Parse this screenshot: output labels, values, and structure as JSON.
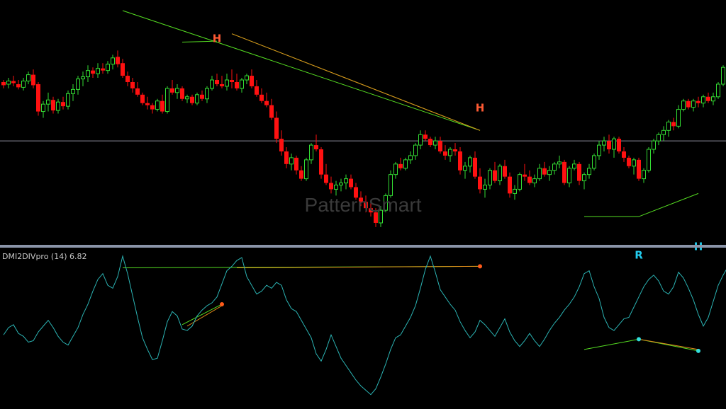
{
  "watermark": "PatternSmart",
  "indicator": {
    "title": "DMI2DIVpro (14) 6.82"
  },
  "colors": {
    "background": "#000000",
    "bull": "#33dd33",
    "bear": "#ff1111",
    "hline": "#8a8a9a",
    "separator": "#8a94a8",
    "line": "#2bb3b3",
    "green_trend": "#55dd22",
    "orange_trend": "#e08a1a",
    "label_orange": "#ff5a33",
    "label_cyan": "#22ccee",
    "dot_orange": "#ff5a1a",
    "dot_cyan": "#33dddd"
  },
  "chart_data": [
    {
      "type": "candlestick",
      "name": "price",
      "price_range": [
        0,
        100
      ],
      "horizontal_line": 38,
      "candles": [
        [
          66,
          67,
          63,
          64.5
        ],
        [
          65,
          68,
          63,
          66.5
        ],
        [
          66.5,
          69,
          64,
          65.5
        ],
        [
          65,
          67,
          62.5,
          63.5
        ],
        [
          63.5,
          68,
          62,
          66.5
        ],
        [
          66.5,
          71,
          65,
          69.5
        ],
        [
          69.5,
          72,
          63,
          64.5
        ],
        [
          65,
          66,
          50,
          52
        ],
        [
          52,
          57,
          49,
          55.5
        ],
        [
          55.5,
          61,
          52,
          57.5
        ],
        [
          57.5,
          59,
          51,
          52.5
        ],
        [
          52.5,
          58,
          51,
          56.5
        ],
        [
          56.5,
          59,
          53,
          54.5
        ],
        [
          54.5,
          62,
          53,
          60.5
        ],
        [
          60.5,
          65,
          57,
          62.5
        ],
        [
          62.5,
          69,
          60,
          67.5
        ],
        [
          67.5,
          71,
          64,
          68.5
        ],
        [
          68.5,
          74,
          66,
          71.5
        ],
        [
          71.5,
          73,
          68,
          70
        ],
        [
          70,
          75,
          68,
          72.5
        ],
        [
          72.5,
          75,
          70,
          71.5
        ],
        [
          71.5,
          76,
          70,
          74.5
        ],
        [
          74.5,
          79,
          72,
          77.5
        ],
        [
          78,
          81,
          73,
          74.5
        ],
        [
          75,
          77,
          68,
          69
        ],
        [
          69,
          71,
          64,
          66
        ],
        [
          66,
          68,
          61,
          63
        ],
        [
          63,
          66,
          59,
          60
        ],
        [
          60,
          61,
          55,
          56
        ],
        [
          56,
          59,
          53,
          55
        ],
        [
          55,
          56,
          51,
          53
        ],
        [
          53,
          58,
          52,
          57
        ],
        [
          57,
          60,
          51,
          52
        ],
        [
          52,
          64,
          51,
          63
        ],
        [
          63,
          67,
          60,
          61
        ],
        [
          61,
          65,
          58,
          63
        ],
        [
          63,
          64,
          57,
          58
        ],
        [
          58,
          60,
          56,
          59
        ],
        [
          59,
          60,
          55,
          56
        ],
        [
          56,
          61,
          55,
          60
        ],
        [
          60,
          62,
          57,
          58
        ],
        [
          58,
          64,
          56,
          63
        ],
        [
          63,
          69,
          62,
          67
        ],
        [
          67,
          70,
          64,
          65
        ],
        [
          65,
          69,
          63,
          64
        ],
        [
          64,
          70,
          62,
          67
        ],
        [
          67,
          72,
          63,
          66
        ],
        [
          66,
          70,
          62,
          63
        ],
        [
          63,
          68,
          61,
          67
        ],
        [
          67,
          70,
          65,
          69
        ],
        [
          69,
          72,
          63,
          64
        ],
        [
          64,
          67,
          59,
          60
        ],
        [
          60,
          63,
          56,
          57
        ],
        [
          57,
          61,
          54,
          55
        ],
        [
          55,
          58,
          48,
          49
        ],
        [
          49,
          52,
          37,
          39
        ],
        [
          39,
          43,
          31,
          33
        ],
        [
          33,
          35,
          25,
          27
        ],
        [
          27,
          32,
          24,
          30
        ],
        [
          30,
          31,
          22,
          24
        ],
        [
          24,
          26,
          19,
          20
        ],
        [
          20,
          30,
          19,
          29
        ],
        [
          29,
          37,
          27,
          36
        ],
        [
          36,
          41,
          33,
          34
        ],
        [
          34,
          35,
          20,
          22
        ],
        [
          22,
          27,
          17,
          18
        ],
        [
          18,
          21,
          13,
          15
        ],
        [
          15,
          19,
          12,
          17
        ],
        [
          17,
          20,
          14,
          18
        ],
        [
          18,
          22,
          15,
          20
        ],
        [
          20,
          22,
          15,
          16
        ],
        [
          16,
          18,
          10,
          11
        ],
        [
          11,
          14,
          7,
          9
        ],
        [
          9,
          12,
          4,
          6
        ],
        [
          6,
          10,
          2,
          4
        ],
        [
          4,
          6,
          -3,
          -1
        ],
        [
          -1,
          7,
          -3,
          5
        ],
        [
          5,
          13,
          4,
          12
        ],
        [
          12,
          24,
          11,
          22
        ],
        [
          22,
          28,
          20,
          27
        ],
        [
          27,
          30,
          24,
          25
        ],
        [
          25,
          30,
          24,
          29
        ],
        [
          29,
          33,
          27,
          31
        ],
        [
          31,
          37,
          29,
          36
        ],
        [
          36,
          43,
          34,
          41
        ],
        [
          41,
          43,
          38,
          39
        ],
        [
          39,
          40,
          35,
          36
        ],
        [
          36,
          40,
          34,
          38
        ],
        [
          38,
          40,
          32,
          33
        ],
        [
          33,
          36,
          29,
          31
        ],
        [
          31,
          35,
          28,
          34
        ],
        [
          34,
          37,
          31,
          33
        ],
        [
          33,
          35,
          22,
          24
        ],
        [
          24,
          28,
          20,
          26
        ],
        [
          26,
          31,
          23,
          30
        ],
        [
          30,
          33,
          20,
          21
        ],
        [
          21,
          25,
          13,
          15
        ],
        [
          15,
          20,
          11,
          17
        ],
        [
          17,
          25,
          15,
          24
        ],
        [
          24,
          28,
          18,
          19
        ],
        [
          19,
          27,
          17,
          26
        ],
        [
          26,
          29,
          20,
          21
        ],
        [
          21,
          23,
          11,
          13
        ],
        [
          13,
          17,
          10,
          15
        ],
        [
          15,
          23,
          14,
          22
        ],
        [
          22,
          27,
          19,
          21
        ],
        [
          21,
          24,
          17,
          18
        ],
        [
          18,
          22,
          16,
          20
        ],
        [
          20,
          27,
          19,
          25
        ],
        [
          25,
          28,
          21,
          22
        ],
        [
          22,
          26,
          19,
          24
        ],
        [
          24,
          28,
          22,
          27
        ],
        [
          27,
          31,
          25,
          28
        ],
        [
          28,
          29,
          17,
          18
        ],
        [
          18,
          26,
          16,
          25
        ],
        [
          25,
          29,
          24,
          27
        ],
        [
          27,
          28,
          17,
          19
        ],
        [
          19,
          23,
          15,
          22
        ],
        [
          22,
          27,
          20,
          25
        ],
        [
          25,
          32,
          24,
          31
        ],
        [
          31,
          38,
          29,
          36
        ],
        [
          36,
          40,
          33,
          38
        ],
        [
          38,
          41,
          32,
          34
        ],
        [
          34,
          40,
          30,
          39
        ],
        [
          39,
          40,
          32,
          33
        ],
        [
          33,
          35,
          28,
          30
        ],
        [
          30,
          31,
          25,
          26
        ],
        [
          26,
          30,
          22,
          29
        ],
        [
          29,
          30,
          19,
          20
        ],
        [
          20,
          25,
          18,
          24
        ],
        [
          24,
          35,
          23,
          34
        ],
        [
          34,
          39,
          32,
          38
        ],
        [
          38,
          42,
          36,
          41
        ],
        [
          41,
          45,
          38,
          43
        ],
        [
          43,
          48,
          40,
          47
        ],
        [
          47,
          49,
          43,
          45
        ],
        [
          45,
          55,
          44,
          53
        ],
        [
          53,
          58,
          52,
          57
        ],
        [
          57,
          58,
          53,
          54
        ],
        [
          54,
          58,
          52,
          57
        ],
        [
          57,
          59,
          54,
          56
        ],
        [
          56,
          60,
          54,
          59
        ],
        [
          59,
          61,
          56,
          57
        ],
        [
          57,
          61,
          55,
          59
        ],
        [
          59,
          66,
          58,
          65
        ],
        [
          65,
          74,
          64,
          73
        ],
        [
          73,
          82,
          72,
          81
        ],
        [
          81,
          88,
          80,
          86
        ],
        [
          86,
          90,
          84,
          88
        ],
        [
          88,
          91,
          85,
          87
        ],
        [
          87,
          89,
          83,
          84
        ],
        [
          84,
          89,
          83,
          88
        ],
        [
          88,
          90,
          84,
          85
        ],
        [
          85,
          87,
          81,
          82
        ],
        [
          82,
          85,
          79,
          83
        ],
        [
          83,
          86,
          78,
          79
        ]
      ],
      "lines": [
        {
          "color": "green",
          "from": [
            24,
            100
          ],
          "to": [
            96,
            43
          ]
        },
        {
          "color": "green",
          "from": [
            36,
            85
          ],
          "to": [
            43,
            85.5
          ]
        },
        {
          "color": "green",
          "from": [
            46,
            89
          ],
          "to": [
            96,
            43
          ]
        },
        {
          "color": "orange",
          "from": [
            46,
            89
          ],
          "to": [
            96,
            43
          ]
        },
        {
          "color": "green",
          "from": [
            117,
            2
          ],
          "to": [
            128,
            2
          ]
        },
        {
          "color": "green",
          "from": [
            128,
            2
          ],
          "to": [
            140,
            13
          ]
        }
      ],
      "labels": [
        {
          "text": "H",
          "at": [
            43,
            85
          ],
          "color": "orange"
        },
        {
          "text": "H",
          "at": [
            96,
            52
          ],
          "color": "orange"
        },
        {
          "text": "R",
          "at": [
            128,
            -18
          ],
          "color": "cyan"
        },
        {
          "text": "H",
          "at": [
            140,
            -14
          ],
          "color": "cyan"
        }
      ]
    },
    {
      "type": "line",
      "name": "DMI2DIVpro (14) 6.82",
      "value_range": [
        0,
        100
      ],
      "values": [
        46,
        51,
        53,
        47,
        45,
        41,
        42,
        48,
        52,
        56,
        51,
        45,
        41,
        39,
        45,
        51,
        60,
        67,
        76,
        84,
        88,
        80,
        78,
        86,
        100,
        88,
        73,
        58,
        44,
        36,
        29,
        30,
        42,
        55,
        62,
        59,
        50,
        49,
        52,
        59,
        63,
        66,
        68,
        72,
        81,
        90,
        93,
        97,
        99,
        86,
        80,
        74,
        76,
        80,
        78,
        82,
        80,
        70,
        64,
        62,
        56,
        50,
        44,
        33,
        28,
        36,
        46,
        38,
        30,
        25,
        20,
        15,
        11,
        8,
        5,
        9,
        17,
        26,
        36,
        44,
        46,
        52,
        58,
        66,
        78,
        91,
        100,
        89,
        77,
        72,
        67,
        63,
        55,
        49,
        44,
        48,
        56,
        53,
        49,
        45,
        51,
        57,
        48,
        42,
        38,
        42,
        47,
        42,
        38,
        43,
        49,
        54,
        58,
        63,
        67,
        72,
        79,
        88,
        90,
        79,
        71,
        58,
        51,
        49,
        53,
        57,
        58,
        65,
        72,
        79,
        84,
        87,
        83,
        76,
        74,
        79,
        89,
        85,
        78,
        70,
        60,
        52,
        58,
        69,
        80,
        87,
        93,
        98,
        90,
        80,
        79,
        72,
        66,
        60,
        55,
        53
      ],
      "lines": [
        {
          "color": "green",
          "from": [
            24,
            92
          ],
          "to": [
            96,
            93
          ]
        },
        {
          "color": "orange",
          "from": [
            47,
            92
          ],
          "to": [
            96,
            93
          ]
        },
        {
          "color": "green",
          "from": [
            36,
            53
          ],
          "to": [
            44,
            67
          ]
        },
        {
          "color": "orange",
          "from": [
            37,
            52
          ],
          "to": [
            44,
            66
          ]
        },
        {
          "color": "green",
          "from": [
            117,
            36
          ],
          "to": [
            128,
            43
          ]
        },
        {
          "color": "green",
          "from": [
            128,
            43
          ],
          "to": [
            140,
            35
          ]
        },
        {
          "color": "orange",
          "from": [
            128,
            43
          ],
          "to": [
            140,
            36
          ]
        }
      ],
      "dots": [
        {
          "at": [
            44,
            67
          ],
          "color": "orange"
        },
        {
          "at": [
            96,
            93
          ],
          "color": "orange"
        },
        {
          "at": [
            128,
            43
          ],
          "color": "cyan"
        },
        {
          "at": [
            140,
            35
          ],
          "color": "cyan"
        }
      ]
    }
  ]
}
